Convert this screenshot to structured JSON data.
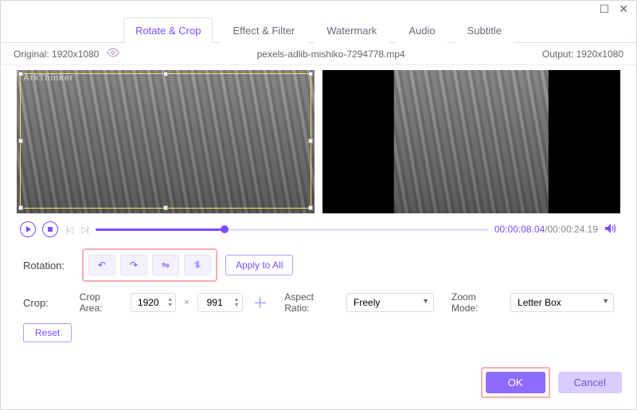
{
  "titlebar": {
    "maximize": "☐",
    "close": "✕"
  },
  "tabs": {
    "items": [
      {
        "label": "Rotate & Crop",
        "active": true
      },
      {
        "label": "Effect & Filter",
        "active": false
      },
      {
        "label": "Watermark",
        "active": false
      },
      {
        "label": "Audio",
        "active": false
      },
      {
        "label": "Subtitle",
        "active": false
      }
    ]
  },
  "infobar": {
    "original_label": "Original:",
    "original_value": "1920x1080",
    "filename": "pexels-adlib-mishiko-7294778.mp4",
    "output_label": "Output:",
    "output_value": "1920x1080"
  },
  "preview": {
    "watermark": "ArkThinker"
  },
  "playbar": {
    "current": "00:00:08.04",
    "total": "/00:00:24.19",
    "progress_percent": 33
  },
  "rotation": {
    "label": "Rotation:",
    "buttons": [
      {
        "name": "rotate-ccw",
        "glyph": "↶"
      },
      {
        "name": "rotate-cw",
        "glyph": "↷"
      },
      {
        "name": "flip-horizontal",
        "glyph": "⇋"
      },
      {
        "name": "flip-vertical",
        "glyph": "⥮"
      }
    ],
    "apply_all": "Apply to All"
  },
  "crop": {
    "label": "Crop:",
    "area_label": "Crop Area:",
    "width": "1920",
    "height": "991",
    "aspect_label": "Aspect Ratio:",
    "aspect_value": "Freely",
    "zoom_label": "Zoom Mode:",
    "zoom_value": "Letter Box",
    "reset": "Reset"
  },
  "footer": {
    "ok": "OK",
    "cancel": "Cancel"
  }
}
